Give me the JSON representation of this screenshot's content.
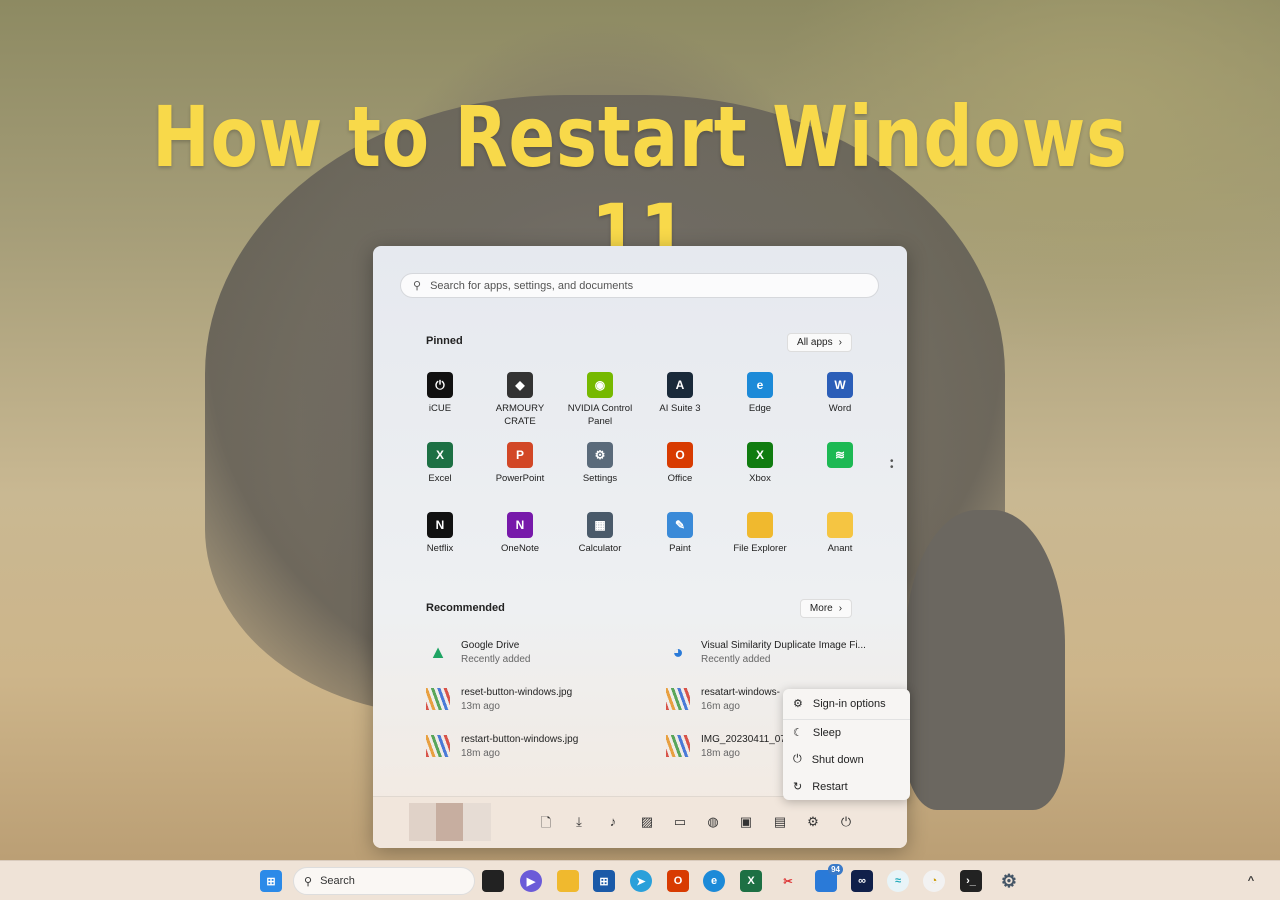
{
  "headline": "How to Restart Windows 11",
  "start_menu": {
    "search_placeholder": "Search for apps, settings, and documents",
    "pinned_label": "Pinned",
    "all_apps_label": "All apps",
    "pinned": [
      {
        "label": "iCUE",
        "icon": "icue-icon",
        "color": "#111111",
        "glyph": "⏻"
      },
      {
        "label": "ARMOURY CRATE",
        "icon": "armoury-crate-icon",
        "color": "#333333",
        "glyph": "◆"
      },
      {
        "label": "NVIDIA Control Panel",
        "icon": "nvidia-icon",
        "color": "#76b900",
        "glyph": "◉"
      },
      {
        "label": "AI Suite 3",
        "icon": "ai-suite-icon",
        "color": "#1a2a3a",
        "glyph": "A"
      },
      {
        "label": "Edge",
        "icon": "edge-icon",
        "color": "#1c8ad8",
        "glyph": "e"
      },
      {
        "label": "Word",
        "icon": "word-icon",
        "color": "#2b5eb8",
        "glyph": "W"
      },
      {
        "label": "Excel",
        "icon": "excel-icon",
        "color": "#1d7044",
        "glyph": "X"
      },
      {
        "label": "PowerPoint",
        "icon": "powerpoint-icon",
        "color": "#d24726",
        "glyph": "P"
      },
      {
        "label": "Settings",
        "icon": "settings-icon",
        "color": "#5a6a7a",
        "glyph": "⚙"
      },
      {
        "label": "Office",
        "icon": "office-icon",
        "color": "#d83b01",
        "glyph": "O"
      },
      {
        "label": "Xbox",
        "icon": "xbox-icon",
        "color": "#107c10",
        "glyph": "X"
      },
      {
        "label": "",
        "icon": "spotify-icon",
        "color": "#1db954",
        "glyph": "≋"
      },
      {
        "label": "Netflix",
        "icon": "netflix-icon",
        "color": "#111111",
        "glyph": "N"
      },
      {
        "label": "OneNote",
        "icon": "onenote-icon",
        "color": "#7719aa",
        "glyph": "N"
      },
      {
        "label": "Calculator",
        "icon": "calculator-icon",
        "color": "#4a5a6a",
        "glyph": "▦"
      },
      {
        "label": "Paint",
        "icon": "paint-icon",
        "color": "#3a8ad8",
        "glyph": "✎"
      },
      {
        "label": "File Explorer",
        "icon": "file-explorer-icon",
        "color": "#f0b92e",
        "glyph": ""
      },
      {
        "label": "Anant",
        "icon": "folder-icon",
        "color": "#f5c542",
        "glyph": ""
      }
    ],
    "recommended_label": "Recommended",
    "more_label": "More",
    "recommended": [
      {
        "name": "Google Drive",
        "sub": "Recently added",
        "icon": "google-drive-icon"
      },
      {
        "name": "Visual Similarity Duplicate Image Fi...",
        "sub": "Recently added",
        "icon": "duplicate-image-finder-icon"
      },
      {
        "name": "reset-button-windows.jpg",
        "sub": "13m ago",
        "icon": "image-file-icon"
      },
      {
        "name": "resatart-windows-",
        "sub": "16m ago",
        "icon": "image-file-icon"
      },
      {
        "name": "restart-button-windows.jpg",
        "sub": "18m ago",
        "icon": "image-file-icon"
      },
      {
        "name": "IMG_20230411_07",
        "sub": "18m ago",
        "icon": "image-file-icon"
      }
    ]
  },
  "power_menu": [
    "Sign-in options",
    "Sleep",
    "Shut down",
    "Restart"
  ],
  "taskbar": {
    "search_label": "Search",
    "chat_badge": "94"
  }
}
